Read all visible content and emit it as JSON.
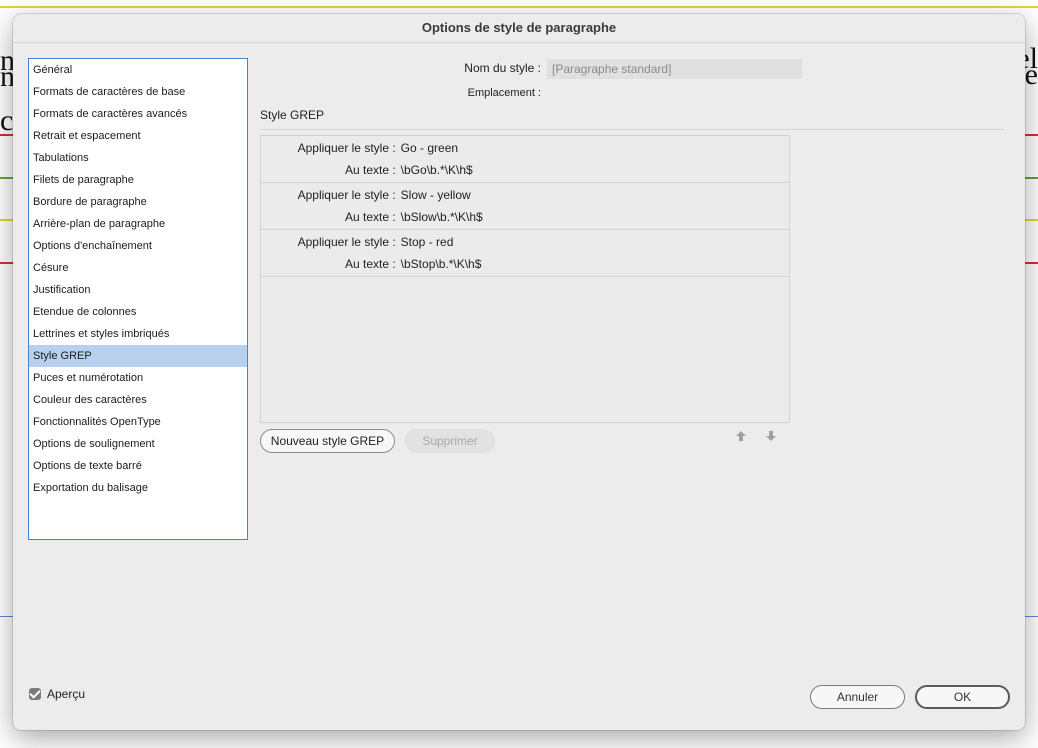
{
  "background": {
    "left_fragments": [
      "n",
      "n",
      "c"
    ],
    "right_fragments": [
      "el",
      "·e"
    ]
  },
  "dialog": {
    "title": "Options de style de paragraphe"
  },
  "categories": [
    {
      "label": "Général",
      "selected": false
    },
    {
      "label": "Formats de caractères de base",
      "selected": false
    },
    {
      "label": "Formats de caractères avancés",
      "selected": false
    },
    {
      "label": "Retrait et espacement",
      "selected": false
    },
    {
      "label": "Tabulations",
      "selected": false
    },
    {
      "label": "Filets de paragraphe",
      "selected": false
    },
    {
      "label": "Bordure de paragraphe",
      "selected": false
    },
    {
      "label": "Arrière-plan de paragraphe",
      "selected": false
    },
    {
      "label": "Options d'enchaînement",
      "selected": false
    },
    {
      "label": "Césure",
      "selected": false
    },
    {
      "label": "Justification",
      "selected": false
    },
    {
      "label": "Etendue de colonnes",
      "selected": false
    },
    {
      "label": "Lettrines et styles imbriqués",
      "selected": false
    },
    {
      "label": "Style GREP",
      "selected": true
    },
    {
      "label": "Puces et numérotation",
      "selected": false
    },
    {
      "label": "Couleur des caractères",
      "selected": false
    },
    {
      "label": "Fonctionnalités OpenType",
      "selected": false
    },
    {
      "label": "Options de soulignement",
      "selected": false
    },
    {
      "label": "Options de texte barré",
      "selected": false
    },
    {
      "label": "Exportation du balisage",
      "selected": false
    }
  ],
  "style_name": {
    "label": "Nom du style :",
    "value": "[Paragraphe standard]",
    "location_label": "Emplacement :"
  },
  "section": {
    "title": "Style GREP"
  },
  "grep_rules": [
    {
      "apply_label": "Appliquer le style",
      "style": "Go - green",
      "text_label": "Au texte",
      "pattern": "\\bGo\\b.*\\K\\h$"
    },
    {
      "apply_label": "Appliquer le style",
      "style": "Slow - yellow",
      "text_label": "Au texte",
      "pattern": "\\bSlow\\b.*\\K\\h$"
    },
    {
      "apply_label": "Appliquer le style",
      "style": "Stop - red",
      "text_label": "Au texte",
      "pattern": "\\bStop\\b.*\\K\\h$"
    }
  ],
  "grep_buttons": {
    "new_label": "Nouveau style GREP",
    "delete_label": "Supprimer",
    "move_up_icon": "arrow-up-icon",
    "move_down_icon": "arrow-down-icon"
  },
  "footer": {
    "preview_label": "Aperçu",
    "preview_checked": true,
    "cancel_label": "Annuler",
    "ok_label": "OK"
  },
  "colors": {
    "selection": "#b6d0ee",
    "list_border": "#3b86d9",
    "dialog_bg": "#ececec",
    "rule_red": "#d4322c",
    "rule_green": "#5aa637",
    "rule_yellow": "#e3d62a"
  }
}
